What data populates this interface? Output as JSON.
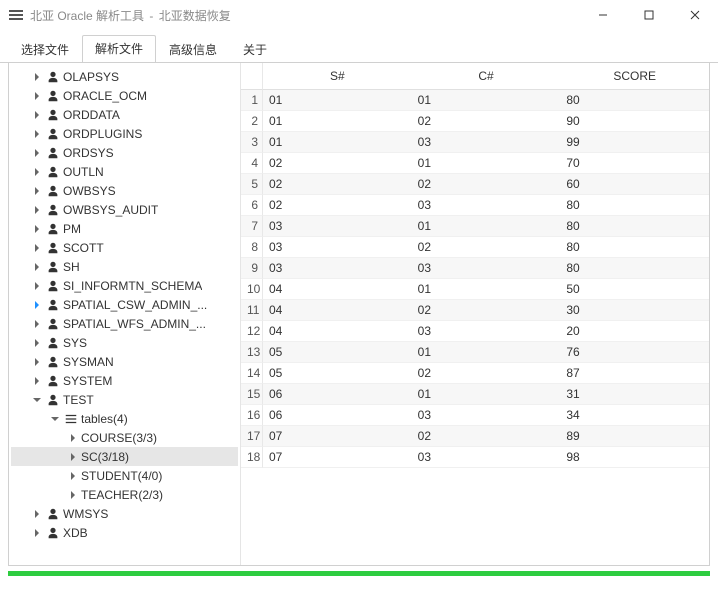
{
  "window": {
    "app_name": "北亚 Oracle 解析工具",
    "sub_title": "北亚数据恢复",
    "sep": "-"
  },
  "tabs": {
    "items": [
      {
        "label": "选择文件",
        "active": false
      },
      {
        "label": "解析文件",
        "active": true
      },
      {
        "label": "高级信息",
        "active": false
      },
      {
        "label": "关于",
        "active": false
      }
    ]
  },
  "tree": {
    "items": [
      {
        "label": "OLAPSYS",
        "depth": 1,
        "kind": "user",
        "expandable": true
      },
      {
        "label": "ORACLE_OCM",
        "depth": 1,
        "kind": "user",
        "expandable": true
      },
      {
        "label": "ORDDATA",
        "depth": 1,
        "kind": "user",
        "expandable": true
      },
      {
        "label": "ORDPLUGINS",
        "depth": 1,
        "kind": "user",
        "expandable": true
      },
      {
        "label": "ORDSYS",
        "depth": 1,
        "kind": "user",
        "expandable": true
      },
      {
        "label": "OUTLN",
        "depth": 1,
        "kind": "user",
        "expandable": true
      },
      {
        "label": "OWBSYS",
        "depth": 1,
        "kind": "user",
        "expandable": true
      },
      {
        "label": "OWBSYS_AUDIT",
        "depth": 1,
        "kind": "user",
        "expandable": true
      },
      {
        "label": "PM",
        "depth": 1,
        "kind": "user",
        "expandable": true
      },
      {
        "label": "SCOTT",
        "depth": 1,
        "kind": "user",
        "expandable": true
      },
      {
        "label": "SH",
        "depth": 1,
        "kind": "user",
        "expandable": true
      },
      {
        "label": "SI_INFORMTN_SCHEMA",
        "depth": 1,
        "kind": "user",
        "expandable": true
      },
      {
        "label": "SPATIAL_CSW_ADMIN_...",
        "depth": 1,
        "kind": "user",
        "expandable": true,
        "highlight_toggle": true
      },
      {
        "label": "SPATIAL_WFS_ADMIN_...",
        "depth": 1,
        "kind": "user",
        "expandable": true
      },
      {
        "label": "SYS",
        "depth": 1,
        "kind": "user",
        "expandable": true
      },
      {
        "label": "SYSMAN",
        "depth": 1,
        "kind": "user",
        "expandable": true
      },
      {
        "label": "SYSTEM",
        "depth": 1,
        "kind": "user",
        "expandable": true
      },
      {
        "label": "TEST",
        "depth": 1,
        "kind": "user",
        "expandable": true,
        "expanded": true
      },
      {
        "label": "tables(4)",
        "depth": 2,
        "kind": "folder",
        "expandable": true,
        "expanded": true
      },
      {
        "label": "COURSE(3/3)",
        "depth": 3,
        "kind": "leaf",
        "expandable": true
      },
      {
        "label": "SC(3/18)",
        "depth": 3,
        "kind": "leaf",
        "expandable": true,
        "selected": true
      },
      {
        "label": "STUDENT(4/0)",
        "depth": 3,
        "kind": "leaf",
        "expandable": true
      },
      {
        "label": "TEACHER(2/3)",
        "depth": 3,
        "kind": "leaf",
        "expandable": true
      },
      {
        "label": "WMSYS",
        "depth": 1,
        "kind": "user",
        "expandable": true
      },
      {
        "label": "XDB",
        "depth": 1,
        "kind": "user",
        "expandable": true
      }
    ]
  },
  "table": {
    "columns": [
      "S#",
      "C#",
      "SCORE"
    ],
    "rows": [
      [
        "01",
        "01",
        "80"
      ],
      [
        "01",
        "02",
        "90"
      ],
      [
        "01",
        "03",
        "99"
      ],
      [
        "02",
        "01",
        "70"
      ],
      [
        "02",
        "02",
        "60"
      ],
      [
        "02",
        "03",
        "80"
      ],
      [
        "03",
        "01",
        "80"
      ],
      [
        "03",
        "02",
        "80"
      ],
      [
        "03",
        "03",
        "80"
      ],
      [
        "04",
        "01",
        "50"
      ],
      [
        "04",
        "02",
        "30"
      ],
      [
        "04",
        "03",
        "20"
      ],
      [
        "05",
        "01",
        "76"
      ],
      [
        "05",
        "02",
        "87"
      ],
      [
        "06",
        "01",
        "31"
      ],
      [
        "06",
        "03",
        "34"
      ],
      [
        "07",
        "02",
        "89"
      ],
      [
        "07",
        "03",
        "98"
      ]
    ]
  }
}
